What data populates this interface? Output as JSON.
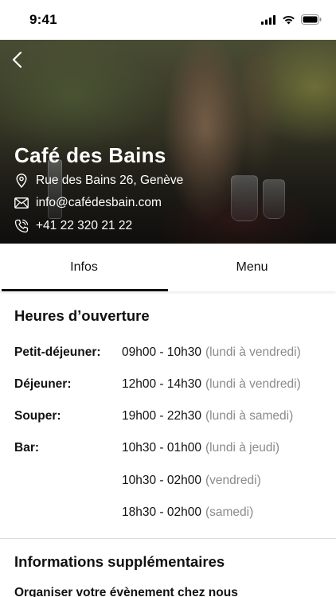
{
  "status_bar": {
    "time": "9:41"
  },
  "hero": {
    "name": "Café des Bains",
    "address": "Rue des Bains 26, Genève",
    "email": "info@cafédesbain.com",
    "phone": "+41 22 320 21 22"
  },
  "tabs": [
    {
      "label": "Infos",
      "active": true
    },
    {
      "label": "Menu",
      "active": false
    }
  ],
  "hours": {
    "title": "Heures d’ouverture",
    "rows": [
      {
        "label": "Petit-déjeuner:",
        "time": "09h00 - 10h30",
        "days": "(lundi à vendredi)"
      },
      {
        "label": "Déjeuner:",
        "time": "12h00 - 14h30",
        "days": "(lundi à vendredi)"
      },
      {
        "label": "Souper:",
        "time": "19h00 - 22h30",
        "days": "(lundi à samedi)"
      },
      {
        "label": "Bar:",
        "time": "10h30 - 01h00",
        "days": "(lundi à jeudi)"
      },
      {
        "label": "",
        "time": "10h30 - 02h00",
        "days": "(vendredi)"
      },
      {
        "label": "",
        "time": "18h30 - 02h00",
        "days": "(samedi)"
      }
    ]
  },
  "extra": {
    "title": "Informations supplémentaires",
    "line1": "Organiser votre évènement chez nous"
  },
  "colors": {
    "muted_text": "#8a8a8f",
    "tab_indicator": "#111111"
  },
  "icons": [
    "back-chevron-icon",
    "location-pin-icon",
    "envelope-icon",
    "phone-icon",
    "signal-icon",
    "wifi-icon",
    "battery-icon"
  ]
}
